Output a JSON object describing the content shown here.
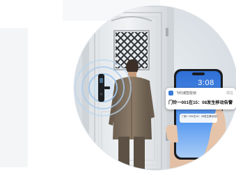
{
  "notification": {
    "app_name": "飞利浦智能锁",
    "time": "现在",
    "message": "门铃一001在15：08发生移动告警"
  },
  "phone": {
    "clock": "3:08",
    "date": "",
    "mini_card_text": "门铃一001在15：08发生移动告警"
  }
}
